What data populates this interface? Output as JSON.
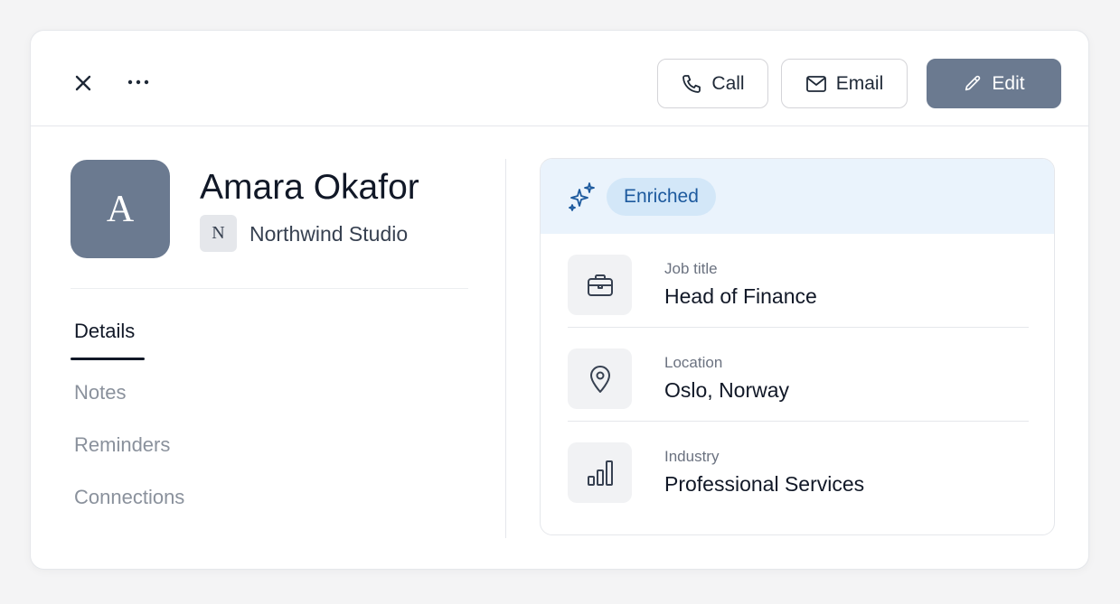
{
  "header": {
    "call_label": "Call",
    "email_label": "Email",
    "edit_label": "Edit"
  },
  "contact": {
    "avatar_initial": "A",
    "name": "Amara Okafor",
    "company_initial": "N",
    "company": "Northwind Studio"
  },
  "tabs": [
    {
      "label": "Details",
      "active": true
    },
    {
      "label": "Notes",
      "active": false
    },
    {
      "label": "Reminders",
      "active": false
    },
    {
      "label": "Connections",
      "active": false
    }
  ],
  "enrichment": {
    "badge": "Enriched",
    "fields": [
      {
        "label": "Job title",
        "value": "Head of Finance",
        "icon": "briefcase-icon"
      },
      {
        "label": "Location",
        "value": "Oslo, Norway",
        "icon": "map-pin-icon"
      },
      {
        "label": "Industry",
        "value": "Professional Services",
        "icon": "bar-chart-icon"
      }
    ]
  },
  "colors": {
    "accent": "#6b7a90",
    "badge_bg": "#d3e7f8",
    "badge_text": "#1d5a9e",
    "panel_header_bg": "#eaf3fc"
  }
}
